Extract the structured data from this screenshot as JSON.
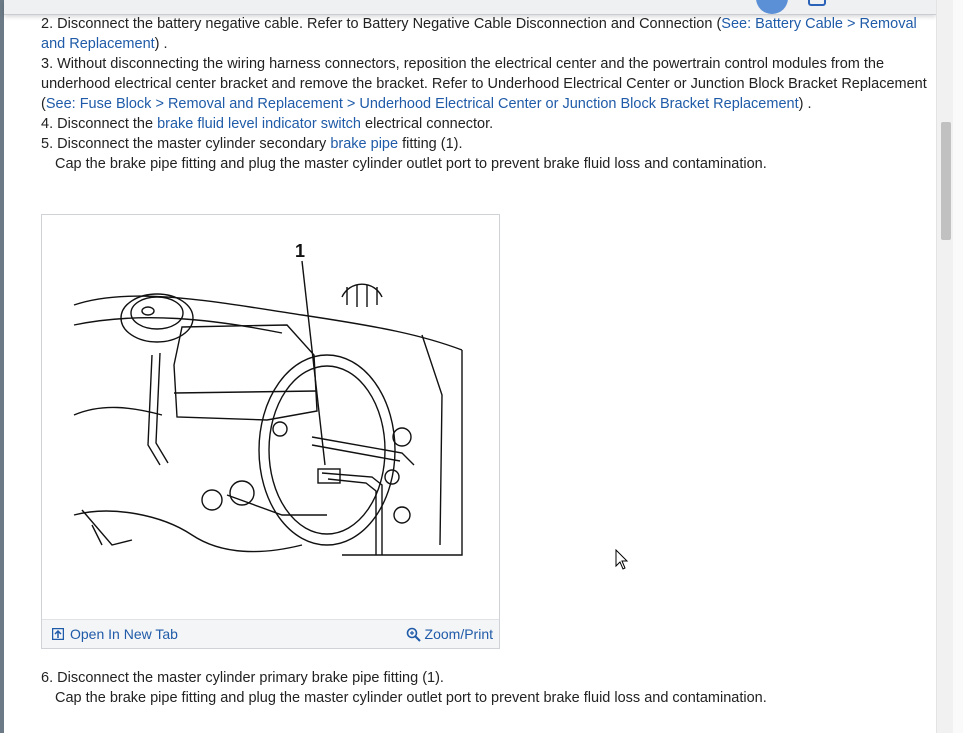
{
  "steps": {
    "s2": {
      "num": "2.",
      "text": "Disconnect the battery negative cable. Refer to Battery Negative Cable Disconnection and Connection (",
      "link": "See: Battery Cable > Removal and Replacement",
      "after": ") ."
    },
    "s3": {
      "num": "3.",
      "text": "Without disconnecting the wiring harness connectors, reposition the electrical center and the powertrain control modules from the underhood electrical center bracket and remove the bracket. Refer to Underhood Electrical Center or Junction Block Bracket Replacement (",
      "link": "See: Fuse Block > Removal and Replacement > Underhood Electrical Center or Junction Block Bracket Replacement",
      "after": ") ."
    },
    "s4": {
      "num": "4.",
      "pre": "Disconnect the ",
      "link": "brake fluid level indicator switch",
      "post": " electrical connector."
    },
    "s5": {
      "num": "5.",
      "pre": "Disconnect the master cylinder secondary ",
      "link": "brake pipe",
      "post": " fitting (1).",
      "note": "Cap the brake pipe fitting and plug the master cylinder outlet port to prevent brake fluid loss and contamination."
    },
    "s6": {
      "num": "6.",
      "text": "Disconnect the master cylinder primary brake pipe fitting (1).",
      "note": "Cap the brake pipe fitting and plug the master cylinder outlet port to prevent brake fluid loss and contamination."
    }
  },
  "figure": {
    "callout": "1",
    "open_tab": "Open In New Tab",
    "zoom_print": "Zoom/Print",
    "open_icon": "open-new-tab-icon",
    "zoom_icon": "zoom-magnifier-icon"
  },
  "colors": {
    "link": "#1f5ba8",
    "text": "#222222"
  }
}
